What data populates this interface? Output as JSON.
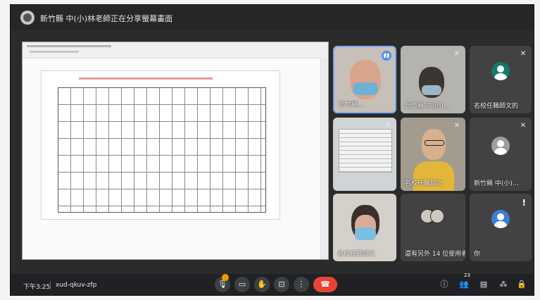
{
  "banner": {
    "text": "新竹縣 中(小)林老師正在分享螢幕畫面"
  },
  "tiles": [
    {
      "label": "新竹縣…"
    },
    {
      "label": "新竹縣 中(小)…"
    },
    {
      "label": "名校任職師文的"
    },
    {
      "label": ""
    },
    {
      "label": "名校任職師文"
    },
    {
      "label": "新竹縣 中(小)…"
    },
    {
      "label": "名校任職師文"
    },
    {
      "label": "還有另外 14 位使用者"
    },
    {
      "label": "你"
    }
  ],
  "bottom_bar": {
    "time": "下午3:25",
    "meeting_code": "xud-qkuv-zfp",
    "people_count": "23"
  },
  "icons": {
    "mic_off": "mic-off-icon",
    "speaking": "speaking-icon",
    "alert": "!"
  },
  "colors": {
    "leave": "#ea4335",
    "speaking_border": "#7aa9f3",
    "mic_badge": "#f29900"
  }
}
